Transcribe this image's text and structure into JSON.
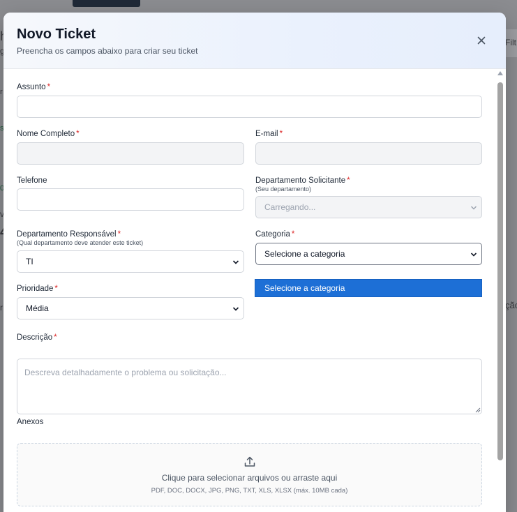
{
  "background": {
    "fragments": [
      "h",
      "g",
      "r",
      "s",
      "0)",
      "v",
      "4",
      "r",
      "Filt",
      "ção"
    ]
  },
  "modal": {
    "title": "Novo Ticket",
    "subtitle": "Preencha os campos abaixo para criar seu ticket",
    "close_icon": "close-icon"
  },
  "form": {
    "assunto": {
      "label": "Assunto",
      "required": "*",
      "value": ""
    },
    "nome": {
      "label": "Nome Completo",
      "required": "*",
      "value": ""
    },
    "email": {
      "label": "E-mail",
      "required": "*",
      "value": ""
    },
    "telefone": {
      "label": "Telefone",
      "value": ""
    },
    "dept_solicitante": {
      "label": "Departamento Solicitante",
      "required": "*",
      "hint": "(Seu departamento)",
      "value": "Carregando..."
    },
    "dept_responsavel": {
      "label": "Departamento Responsável",
      "required": "*",
      "hint": "(Qual departamento deve atender este ticket)",
      "value": "TI"
    },
    "categoria": {
      "label": "Categoria",
      "required": "*",
      "value": "Selecione a categoria",
      "open_option": "Selecione a categoria"
    },
    "prioridade": {
      "label": "Prioridade",
      "required": "*",
      "value": "Média"
    },
    "descricao": {
      "label": "Descrição",
      "required": "*",
      "placeholder": "Descreva detalhadamente o problema ou solicitação..."
    },
    "anexos": {
      "label": "Anexos",
      "drop_text": "Clique para selecionar arquivos ou arraste aqui",
      "formats": "PDF, DOC, DOCX, JPG, PNG, TXT, XLS, XLSX (máx. 10MB cada)",
      "icon": "upload-icon"
    }
  },
  "colors": {
    "accent": "#1d6fd6",
    "required": "#dc2626"
  }
}
